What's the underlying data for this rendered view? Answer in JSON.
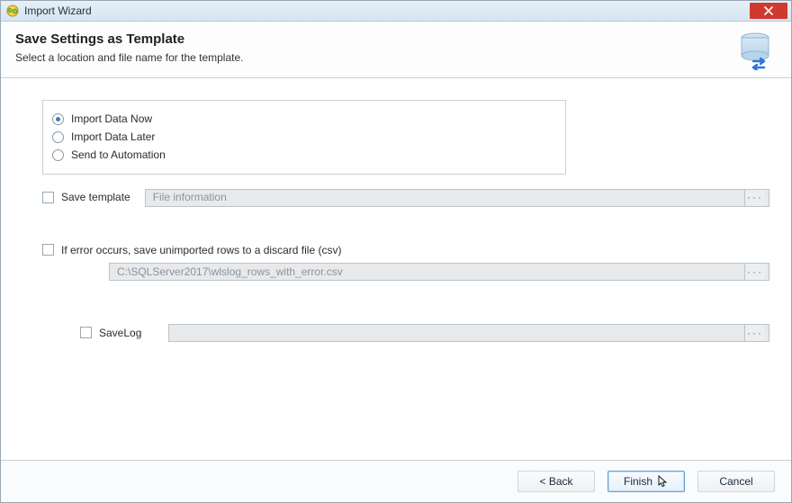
{
  "window": {
    "title": "Import Wizard"
  },
  "header": {
    "title": "Save Settings as Template",
    "subtitle": "Select a location and file name for the template."
  },
  "options": {
    "selected": 0,
    "items": [
      "Import Data Now",
      "Import Data Later",
      "Send to Automation"
    ]
  },
  "saveTemplate": {
    "checked": false,
    "label": "Save template",
    "placeholder": "File information"
  },
  "discard": {
    "checked": false,
    "label": "If error occurs, save unimported rows to a discard file (csv)",
    "path": "C:\\SQLServer2017\\wlslog_rows_with_error.csv"
  },
  "saveLog": {
    "checked": false,
    "label": "SaveLog",
    "path": ""
  },
  "buttons": {
    "back": "< Back",
    "finish": "Finish",
    "cancel": "Cancel"
  },
  "colors": {
    "accent": "#2f6fb7",
    "close": "#cf3a2f"
  }
}
